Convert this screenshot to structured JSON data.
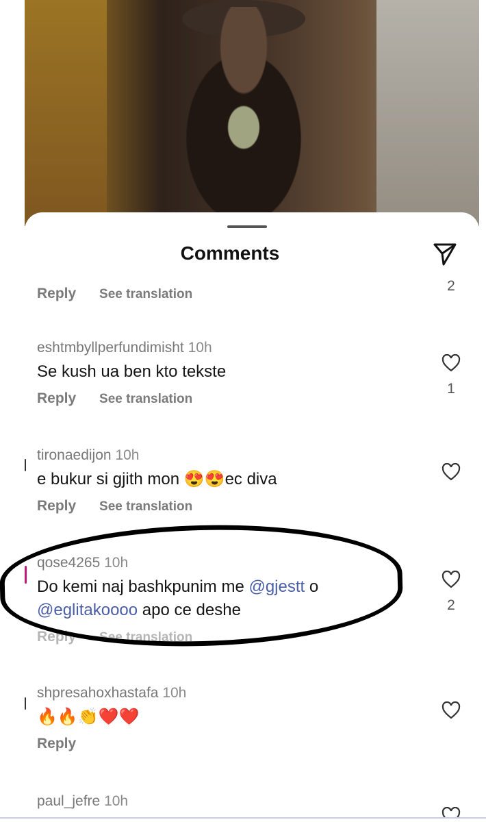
{
  "sheet": {
    "title": "Comments",
    "share_icon": "paper-plane-icon"
  },
  "top_partial": {
    "reply": "Reply",
    "see_translation": "See translation",
    "like_count": "2"
  },
  "comments": [
    {
      "username": "eshtmbyllperfundimisht",
      "time": "10h",
      "text": "Se kush ua ben kto tekste",
      "reply": "Reply",
      "see_translation": "See translation",
      "like_count": "1"
    },
    {
      "username": "tironaedijon",
      "time": "10h",
      "text_before": "e bukur si gjith mon ",
      "emoji1": "😍",
      "emoji2": "😍",
      "text_after": "ec diva",
      "reply": "Reply",
      "see_translation": "See translation",
      "like_count": ""
    },
    {
      "username": "qose4265",
      "time": "10h",
      "text_start": "Do kemi naj bashkpunim me ",
      "mention1": "@gjestt",
      "text_mid": " o",
      "mention2": "@eglitakoooo",
      "text_end": " apo ce deshe",
      "reply": "Reply",
      "see_translation": "See translation",
      "like_count": "2"
    },
    {
      "username": "shpresahoxhastafa",
      "time": "10h",
      "emojis": "🔥🔥👏❤️❤️",
      "reply": "Reply",
      "like_count": ""
    },
    {
      "username": "paul_jefre",
      "time": "10h"
    }
  ],
  "colors": {
    "mention": "#4b5fa8",
    "highlight_ring": "#000000"
  }
}
